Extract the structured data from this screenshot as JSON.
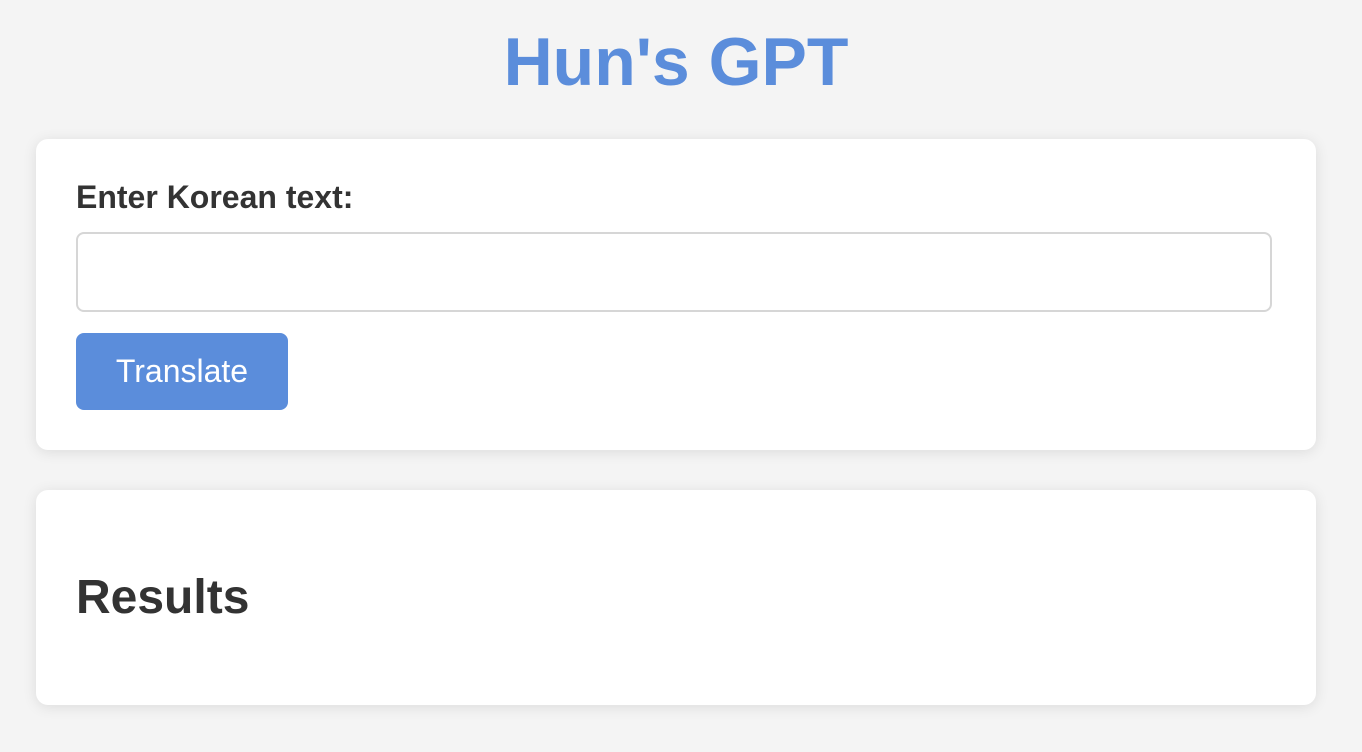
{
  "app": {
    "title": "Hun's GPT",
    "accent_color": "#5b8ddb"
  },
  "form": {
    "label": "Enter Korean text:",
    "input_value": "",
    "input_placeholder": "",
    "submit_label": "Translate"
  },
  "results": {
    "heading": "Results"
  }
}
